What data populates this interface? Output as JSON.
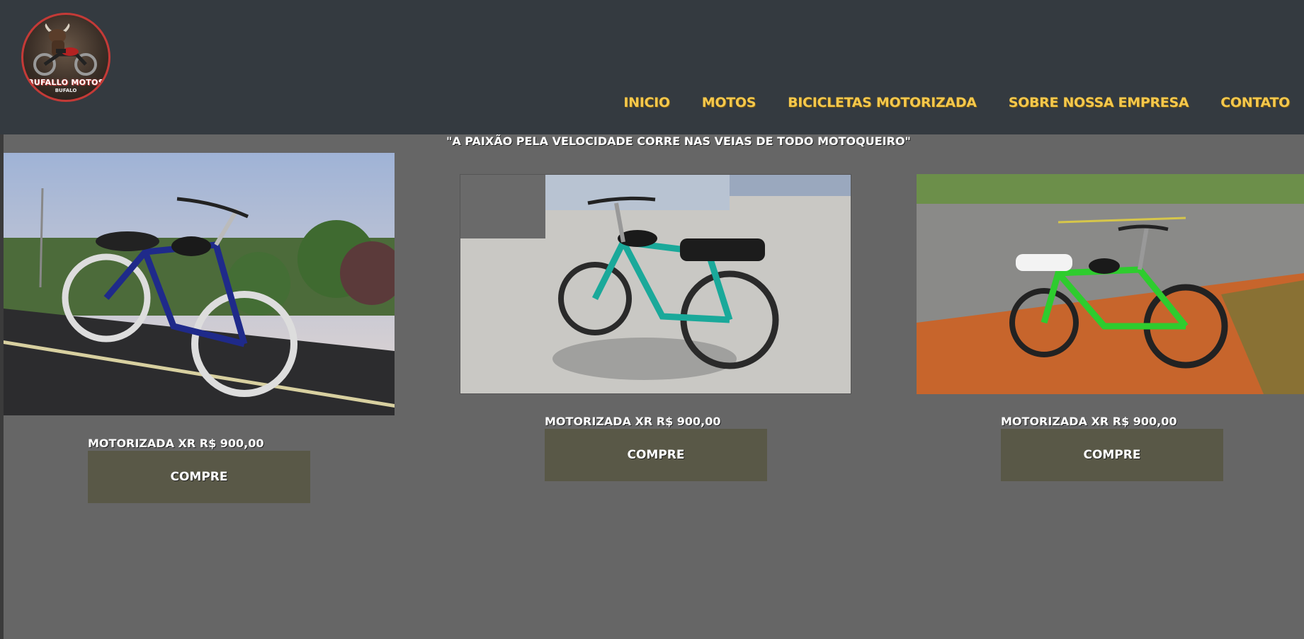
{
  "brand": {
    "logo_title": "BUFALLO MOTOS",
    "logo_subtitle": "BUFALO"
  },
  "nav": {
    "items": [
      {
        "label": "INICIO"
      },
      {
        "label": "MOTOS"
      },
      {
        "label": "BICICLETAS MOTORIZADA"
      },
      {
        "label": "SOBRE NOSSA EMPRESA"
      },
      {
        "label": "CONTATO"
      }
    ]
  },
  "hero": {
    "slogan": "\"A PAIXÃO PELA VELOCIDADE CORRE NAS VEIAS DE TODO MOTOQUEIRO\""
  },
  "products": [
    {
      "caption": "MOTORIZADA XR R$ 900,00",
      "button_label": "COMPRE",
      "frame_color": "#1f2a8a"
    },
    {
      "caption": "MOTORIZADA XR R$ 900,00",
      "button_label": "COMPRE",
      "frame_color": "#1aa99a"
    },
    {
      "caption": "MOTORIZADA XR R$ 900,00",
      "button_label": "COMPRE",
      "frame_color": "#2ecc2e"
    }
  ],
  "colors": {
    "header_bg": "#343a40",
    "nav_text": "#f5c84c",
    "main_bg": "#666666",
    "button_bg": "#595847"
  }
}
